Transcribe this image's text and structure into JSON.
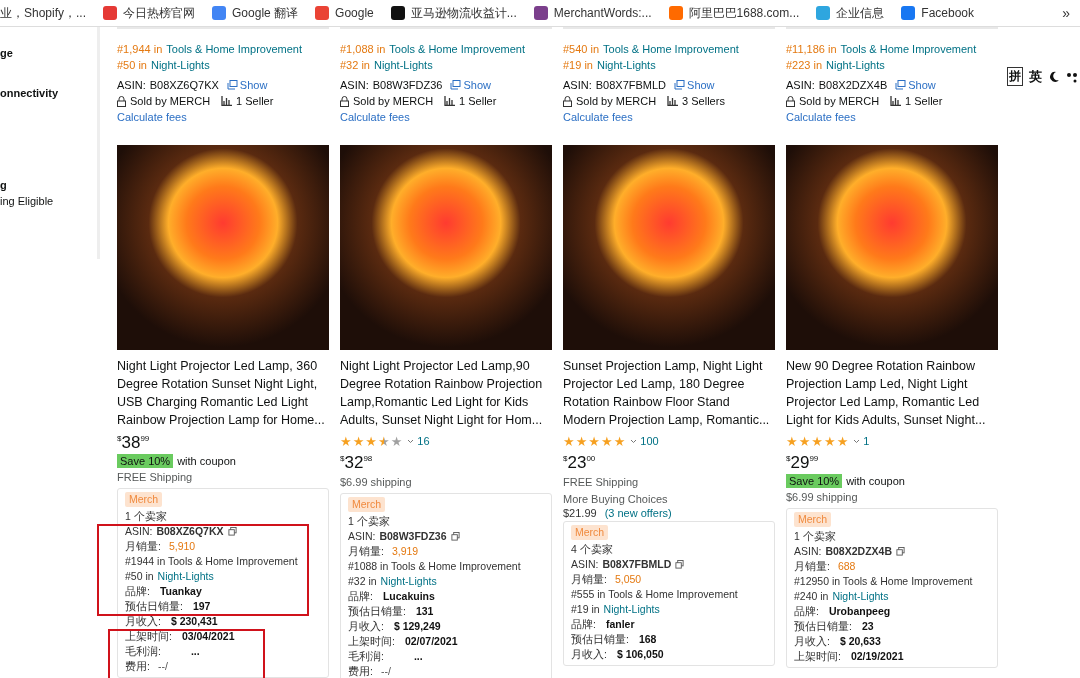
{
  "bookmarks": [
    {
      "label": "业，Shopify，..."
    },
    {
      "label": "今日热榜官网",
      "color": "#e53935"
    },
    {
      "label": "Google 翻译",
      "color": "#4285f4"
    },
    {
      "label": "Google",
      "color": "#ea4335"
    },
    {
      "label": "亚马逊物流收益计...",
      "color": "#111111"
    },
    {
      "label": "MerchantWords:...",
      "color": "#7b3f8c"
    },
    {
      "label": "阿里巴巴1688.com...",
      "color": "#ff6a00"
    },
    {
      "label": "企业信息",
      "color": "#2ea6df"
    },
    {
      "label": "Facebook",
      "color": "#1877f2"
    }
  ],
  "bookmarks_more": "»",
  "sidebar": {
    "items": [
      {
        "label": "ge",
        "kind": "heading"
      },
      {
        "label": "onnectivity",
        "kind": "heading"
      },
      {
        "label": "g",
        "kind": "heading"
      },
      {
        "label": "ing Eligible",
        "kind": "option"
      }
    ]
  },
  "ime_toolbar": {
    "items": [
      "拼",
      "英"
    ]
  },
  "top_cards": [
    {
      "ranks": [
        {
          "prefix": "#1,944 in",
          "category": "Tools & Home Improvement"
        },
        {
          "prefix": "#50 in",
          "category": "Night-Lights"
        }
      ],
      "asin_label": "ASIN:",
      "asin": "B08XZ6Q7KX",
      "show": "Show",
      "sold_by": "Sold by MERCH",
      "sellers": "1 Seller",
      "fees": "Calculate fees"
    },
    {
      "ranks": [
        {
          "prefix": "#1,088 in",
          "category": "Tools & Home Improvement"
        },
        {
          "prefix": "#32 in",
          "category": "Night-Lights"
        }
      ],
      "asin_label": "ASIN:",
      "asin": "B08W3FDZ36",
      "show": "Show",
      "sold_by": "Sold by MERCH",
      "sellers": "1 Seller",
      "fees": "Calculate fees"
    },
    {
      "ranks": [
        {
          "prefix": "#540 in",
          "category": "Tools & Home Improvement"
        },
        {
          "prefix": "#19 in",
          "category": "Night-Lights"
        }
      ],
      "asin_label": "ASIN:",
      "asin": "B08X7FBMLD",
      "show": "Show",
      "sold_by": "Sold by MERCH",
      "sellers": "3 Sellers",
      "fees": "Calculate fees"
    },
    {
      "ranks": [
        {
          "prefix": "#11,186 in",
          "category": "Tools & Home Improvement"
        },
        {
          "prefix": "#223 in",
          "category": "Night-Lights"
        }
      ],
      "asin_label": "ASIN:",
      "asin": "B08X2DZX4B",
      "show": "Show",
      "sold_by": "Sold by MERCH",
      "sellers": "1 Seller",
      "fees": "Calculate fees"
    }
  ],
  "products": [
    {
      "title": "Night Light Projector Led Lamp, 360 Degree Rotation Sunset Night Light, USB Charging Romantic Led Light Rainbow Projection Lamp for Home...",
      "price": {
        "symbol": "$",
        "whole": "38",
        "fraction": "99"
      },
      "coupon": {
        "badge": "Save 10%",
        "text": "with coupon"
      },
      "shipping": "FREE Shipping",
      "panel": {
        "badge": "Merch",
        "sellers": "1 个卖家",
        "rows": [
          {
            "kind": "asin",
            "label": "ASIN:",
            "value": "B08XZ6Q7KX"
          },
          {
            "kind": "sales",
            "label": "月销量:",
            "value": "5,910"
          },
          {
            "kind": "rank",
            "text": "#1944 in Tools & Home Improvement"
          },
          {
            "kind": "subrank",
            "prefix": "#50 in",
            "link": "Night-Lights"
          },
          {
            "kind": "field",
            "label": "品牌:",
            "value": "Tuankay"
          },
          {
            "kind": "field",
            "label": "预估日销量:",
            "value": "197"
          },
          {
            "kind": "field",
            "label": "月收入:",
            "value": "$ 230,431"
          },
          {
            "kind": "field",
            "label": "上架时间:",
            "value": "03/04/2021"
          },
          {
            "kind": "pending",
            "label": "毛利润:",
            "value": "..."
          },
          {
            "kind": "fee",
            "label": "费用:",
            "value": "--/"
          }
        ]
      }
    },
    {
      "title": "Night Light Projector Led Lamp,90 Degree Rotation Rainbow Projection Lamp,Romantic Led Light for Kids Adults, Sunset Night Light for Hom...",
      "stars": 3.5,
      "reviews": "16",
      "price": {
        "symbol": "$",
        "whole": "32",
        "fraction": "98"
      },
      "shipping": "$6.99 shipping",
      "panel": {
        "badge": "Merch",
        "sellers": "1 个卖家",
        "rows": [
          {
            "kind": "asin",
            "label": "ASIN:",
            "value": "B08W3FDZ36"
          },
          {
            "kind": "sales",
            "label": "月销量:",
            "value": "3,919"
          },
          {
            "kind": "rank",
            "text": "#1088 in Tools & Home Improvement"
          },
          {
            "kind": "subrank",
            "prefix": "#32 in",
            "link": "Night-Lights"
          },
          {
            "kind": "field",
            "label": "品牌:",
            "value": "Lucakuins"
          },
          {
            "kind": "field",
            "label": "预估日销量:",
            "value": "131"
          },
          {
            "kind": "field",
            "label": "月收入:",
            "value": "$ 129,249"
          },
          {
            "kind": "field",
            "label": "上架时间:",
            "value": "02/07/2021"
          },
          {
            "kind": "pending",
            "label": "毛利润:",
            "value": "..."
          },
          {
            "kind": "fee",
            "label": "费用:",
            "value": "--/"
          }
        ]
      }
    },
    {
      "title": "Sunset Projection Lamp, Night Light Projector Led Lamp, 180 Degree Rotation Rainbow Floor Stand Modern Projection Lamp, Romantic...",
      "stars": 5,
      "reviews": "100",
      "price": {
        "symbol": "$",
        "whole": "23",
        "fraction": "00"
      },
      "shipping": "FREE Shipping",
      "more_choices": {
        "label": "More Buying Choices",
        "price": "$21.99",
        "offers": "(3 new offers)"
      },
      "panel": {
        "badge": "Merch",
        "sellers": "4 个卖家",
        "rows": [
          {
            "kind": "asin",
            "label": "ASIN:",
            "value": "B08X7FBMLD"
          },
          {
            "kind": "sales",
            "label": "月销量:",
            "value": "5,050"
          },
          {
            "kind": "rank",
            "text": "#555 in Tools & Home Improvement"
          },
          {
            "kind": "subrank",
            "prefix": "#19 in",
            "link": "Night-Lights"
          },
          {
            "kind": "field",
            "label": "品牌:",
            "value": "fanler"
          },
          {
            "kind": "field",
            "label": "预估日销量:",
            "value": "168"
          },
          {
            "kind": "field",
            "label": "月收入:",
            "value": "$ 106,050"
          }
        ]
      }
    },
    {
      "title": "New 90 Degree Rotation Rainbow Projection Lamp Led, Night Light Projector Led Lamp, Romantic Led Light for Kids Adults, Sunset Night...",
      "stars": 5,
      "reviews": "1",
      "price": {
        "symbol": "$",
        "whole": "29",
        "fraction": "99"
      },
      "coupon": {
        "badge": "Save 10%",
        "text": "with coupon"
      },
      "shipping": "$6.99 shipping",
      "panel": {
        "badge": "Merch",
        "sellers": "1 个卖家",
        "rows": [
          {
            "kind": "asin",
            "label": "ASIN:",
            "value": "B08X2DZX4B"
          },
          {
            "kind": "sales",
            "label": "月销量:",
            "value": "688"
          },
          {
            "kind": "rank",
            "text": "#12950 in Tools & Home Improvement"
          },
          {
            "kind": "subrank",
            "prefix": "#240 in",
            "link": "Night-Lights"
          },
          {
            "kind": "field",
            "label": "品牌:",
            "value": "Urobanpeeg"
          },
          {
            "kind": "field",
            "label": "预估日销量:",
            "value": "23"
          },
          {
            "kind": "field",
            "label": "月收入:",
            "value": "$ 20,633"
          },
          {
            "kind": "field",
            "label": "上架时间:",
            "value": "02/19/2021"
          }
        ]
      }
    }
  ]
}
